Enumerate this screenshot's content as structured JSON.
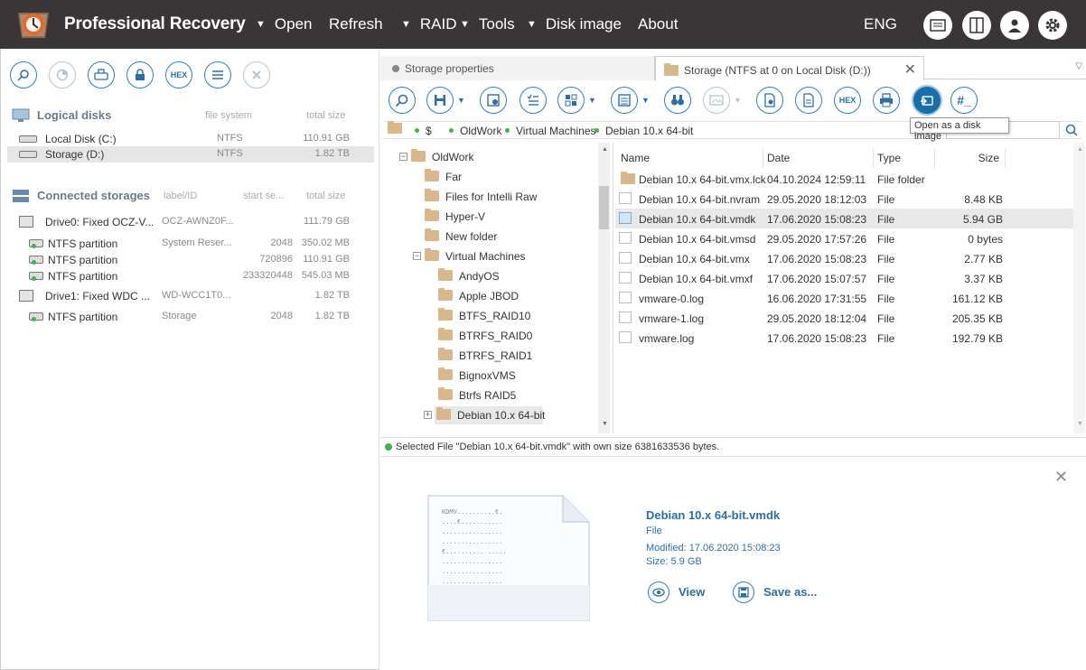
{
  "app": {
    "title": "Professional Recovery",
    "lang": "ENG"
  },
  "menu": [
    {
      "label": "Open",
      "arrow": true
    },
    {
      "label": "Refresh",
      "arrow": false
    },
    {
      "label": "RAID",
      "arrow": true
    },
    {
      "label": "Tools",
      "arrow": true
    },
    {
      "label": "Disk image",
      "arrow": true
    },
    {
      "label": "About",
      "arrow": false
    }
  ],
  "left": {
    "logical": {
      "title": "Logical disks",
      "col_fs": "file system",
      "col_size": "total size",
      "rows": [
        {
          "name": "Local Disk (C:)",
          "fs": "NTFS",
          "size": "110.91 GB"
        },
        {
          "name": "Storage (D:)",
          "fs": "NTFS",
          "size": "1.82 TB"
        }
      ]
    },
    "connected": {
      "title": "Connected storages",
      "col_label": "label/ID",
      "col_start": "start se...",
      "col_size": "total size",
      "rows": [
        {
          "name": "Drive0: Fixed OCZ-V...",
          "label": "OCZ-AWNZ0F...",
          "start": "",
          "size": "111.79 GB"
        },
        {
          "name": "NTFS partition",
          "label": "System Reser...",
          "start": "2048",
          "size": "350.02 MB"
        },
        {
          "name": "NTFS partition",
          "label": "",
          "start": "720896",
          "size": "110.91 GB"
        },
        {
          "name": "NTFS partition",
          "label": "",
          "start": "233320448",
          "size": "545.03 MB"
        },
        {
          "name": "Drive1: Fixed WDC ...",
          "label": "WD-WCC1T0...",
          "start": "",
          "size": "1.82 TB"
        },
        {
          "name": "NTFS partition",
          "label": "Storage",
          "start": "2048",
          "size": "1.82 TB"
        }
      ]
    }
  },
  "tabs": [
    {
      "label": "Storage properties"
    },
    {
      "label": "Storage (NTFS at 0 on Local Disk (D:))"
    }
  ],
  "tooltip": "Open as a disk image",
  "path": [
    "$",
    "OldWork",
    "Virtual Machines",
    "Debian 10.x 64-bit"
  ],
  "tree": [
    {
      "label": "OldWork",
      "exp": "−"
    },
    {
      "label": "Far",
      "exp": ""
    },
    {
      "label": "Files for Intelli Raw",
      "exp": ""
    },
    {
      "label": "Hyper-V",
      "exp": ""
    },
    {
      "label": "New folder",
      "exp": ""
    },
    {
      "label": "Virtual Machines",
      "exp": "−"
    },
    {
      "label": "AndyOS",
      "exp": ""
    },
    {
      "label": "Apple JBOD",
      "exp": ""
    },
    {
      "label": "BTFS_RAID10",
      "exp": ""
    },
    {
      "label": "BTRFS_RAID0",
      "exp": ""
    },
    {
      "label": "BTRFS_RAID1",
      "exp": ""
    },
    {
      "label": "BignoxVMS",
      "exp": ""
    },
    {
      "label": "Btrfs RAID5",
      "exp": ""
    },
    {
      "label": "Debian 10.x 64-bit",
      "exp": "+"
    }
  ],
  "files": {
    "headers": {
      "name": "Name",
      "date": "Date",
      "type": "Type",
      "size": "Size"
    },
    "rows": [
      {
        "name": "Debian 10.x 64-bit.vmx.lck",
        "date": "04.10.2024 12:59:11",
        "type": "File folder",
        "size": ""
      },
      {
        "name": "Debian 10.x 64-bit.nvram",
        "date": "29.05.2020 18:12:03",
        "type": "File",
        "size": "8.48 KB"
      },
      {
        "name": "Debian 10.x 64-bit.vmdk",
        "date": "17.06.2020 15:08:23",
        "type": "File",
        "size": "5.94 GB"
      },
      {
        "name": "Debian 10.x 64-bit.vmsd",
        "date": "29.05.2020 17:57:26",
        "type": "File",
        "size": "0 bytes"
      },
      {
        "name": "Debian 10.x 64-bit.vmx",
        "date": "17.06.2020 15:08:23",
        "type": "File",
        "size": "2.77 KB"
      },
      {
        "name": "Debian 10.x 64-bit.vmxf",
        "date": "17.06.2020 15:07:57",
        "type": "File",
        "size": "3.37 KB"
      },
      {
        "name": "vmware-0.log",
        "date": "16.06.2020 17:31:55",
        "type": "File",
        "size": "161.12 KB"
      },
      {
        "name": "vmware-1.log",
        "date": "29.05.2020 18:12:04",
        "type": "File",
        "size": "205.35 KB"
      },
      {
        "name": "vmware.log",
        "date": "17.06.2020 15:08:23",
        "type": "File",
        "size": "192.79 KB"
      }
    ]
  },
  "status": "Selected File \"Debian 10.x 64-bit.vmdk\" with own size 6381633536 bytes.",
  "preview": {
    "name": "Debian 10.x 64-bit.vmdk",
    "kind": "File",
    "modified": "Modified: 17.06.2020 15:08:23",
    "size": "Size: 5.9 GB",
    "view": "View",
    "save": "Save as...",
    "thumb_lines": [
      "KDMV..........€.",
      "....€...........",
      "................",
      "................",
      "€.......... .....",
      "................",
      "................",
      "................"
    ]
  },
  "colors": {
    "accent": "#2b7fbe",
    "topbar": "#3a3536",
    "selected_btn": "#1a6fa8"
  }
}
